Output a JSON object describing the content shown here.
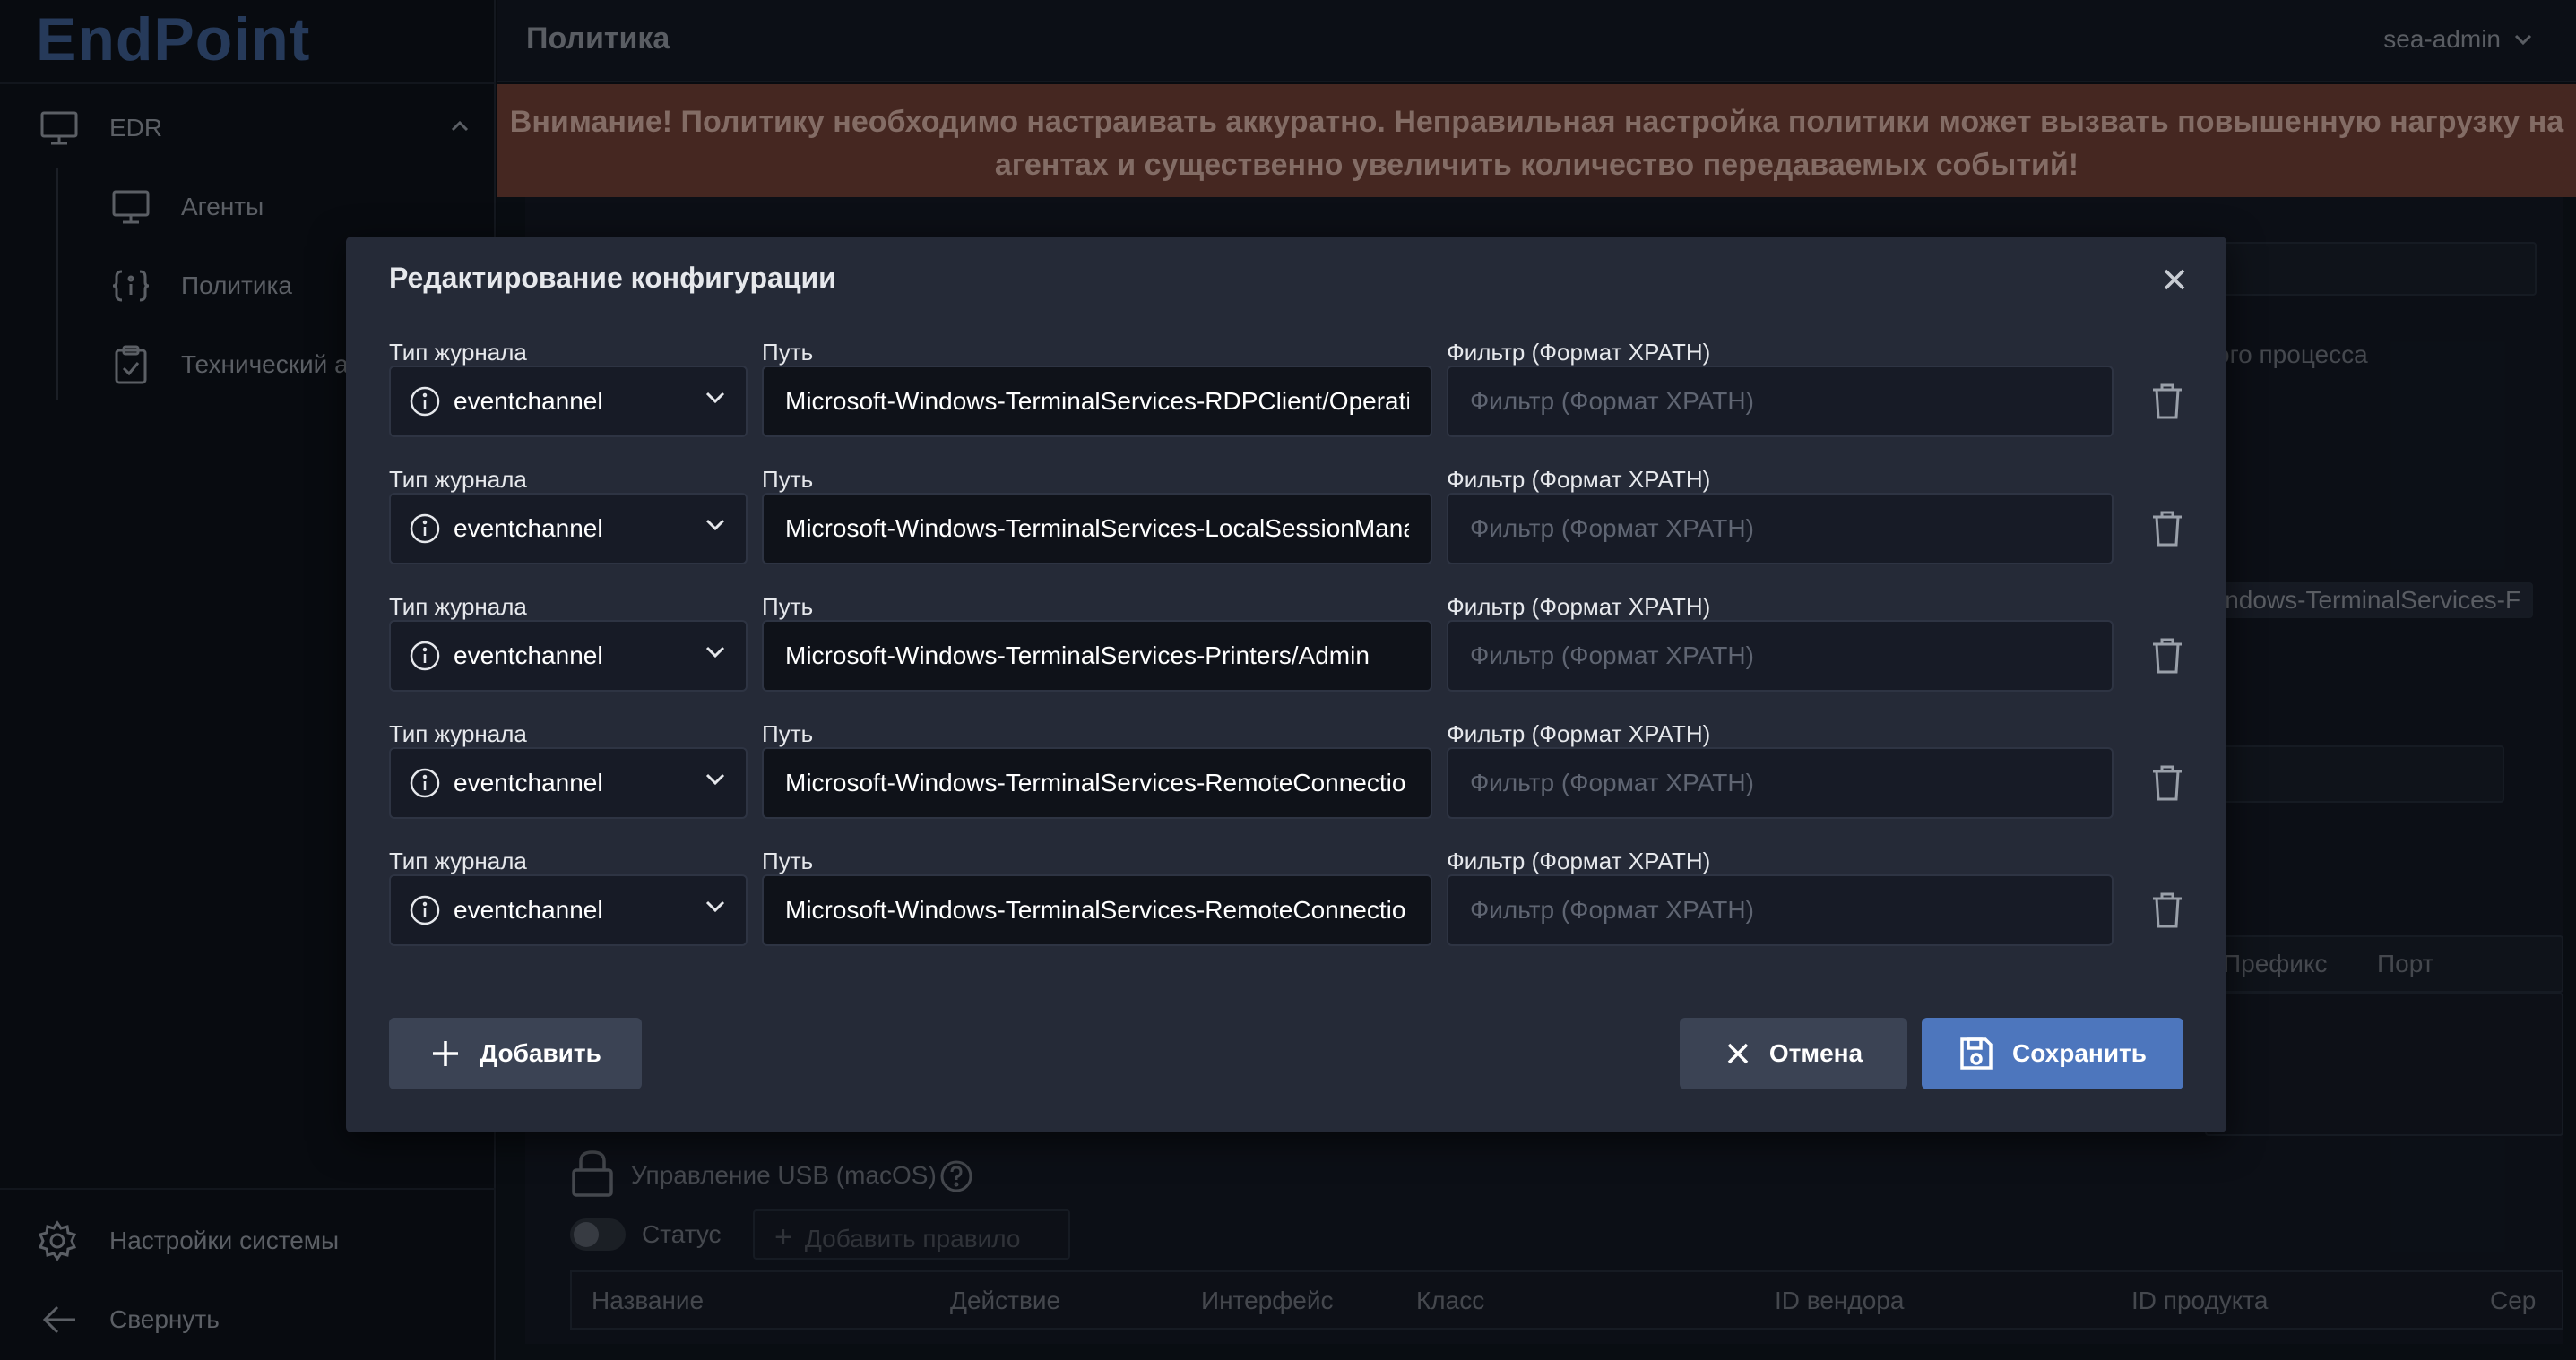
{
  "app": {
    "logo": "EndPoint"
  },
  "sidebar": {
    "section": "EDR",
    "items": [
      {
        "label": "Агенты",
        "icon": "monitor-icon"
      },
      {
        "label": "Политика",
        "icon": "braces-icon"
      },
      {
        "label": "Технический а",
        "icon": "clipboard-icon"
      }
    ],
    "settings_label": "Настройки системы",
    "collapse_label": "Свернуть"
  },
  "header": {
    "title": "Политика",
    "user": "sea-admin"
  },
  "warning": "Внимание! Политику необходимо настраивать аккуратно. Неправильная настройка политики может вызвать повышенную нагрузку на агентах и существенно увеличить количество передаваемых событий!",
  "background": {
    "process_text": "ого процесса",
    "path_fragment": "indows-TerminalServices-F",
    "prefix_col": "Префикс",
    "port_col": "Порт",
    "usb_title": "Управление USB (macOS)",
    "status_label": "Статус",
    "add_rule": "Добавить правило",
    "table_cols": [
      "Название",
      "Действие",
      "Интерфейс",
      "Класс",
      "ID вендора",
      "ID продукта",
      "Сер"
    ]
  },
  "modal": {
    "title": "Редактирование конфигурации",
    "labels": {
      "journal_type": "Тип журнала",
      "path": "Путь",
      "filter": "Фильтр (Формат XPATH)"
    },
    "filter_placeholder": "Фильтр (Формат XPATH)",
    "rows": [
      {
        "type": "eventchannel",
        "path": "Microsoft-Windows-TerminalServices-RDPClient/Operati"
      },
      {
        "type": "eventchannel",
        "path": "Microsoft-Windows-TerminalServices-LocalSessionMana"
      },
      {
        "type": "eventchannel",
        "path": "Microsoft-Windows-TerminalServices-Printers/Admin"
      },
      {
        "type": "eventchannel",
        "path": "Microsoft-Windows-TerminalServices-RemoteConnectio"
      },
      {
        "type": "eventchannel",
        "path": "Microsoft-Windows-TerminalServices-RemoteConnectio"
      }
    ],
    "add_label": "Добавить",
    "cancel_label": "Отмена",
    "save_label": "Сохранить"
  },
  "colors": {
    "accent": "#4d76bd",
    "warning_bg": "#6a3d33",
    "modal_bg": "#252a37"
  }
}
